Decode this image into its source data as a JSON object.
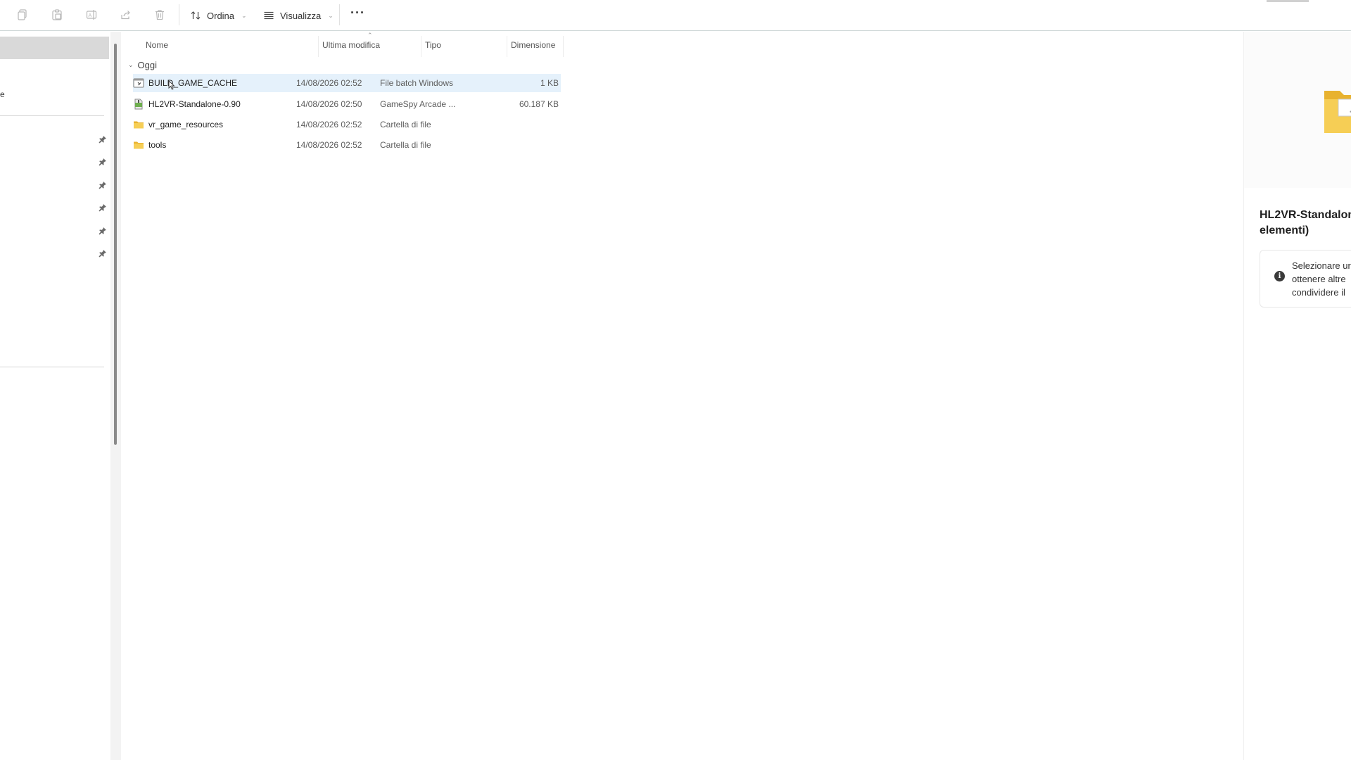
{
  "toolbar": {
    "icons": [
      "copy-icon",
      "paste-icon",
      "rename-icon",
      "share-icon",
      "delete-icon"
    ],
    "sort_label": "Ordina",
    "view_label": "Visualizza",
    "more_label": "···"
  },
  "nav": {
    "partial_label": "e",
    "pinned_count": 6
  },
  "columns": {
    "name": "Nome",
    "modified": "Ultima modifica",
    "type": "Tipo",
    "size": "Dimensione"
  },
  "group": {
    "label": "Oggi"
  },
  "files": [
    {
      "name": "BUILD_GAME_CACHE",
      "modified": "14/08/2026 02:52",
      "type": "File batch Windows",
      "size": "1 KB",
      "icon": "batch-file-icon",
      "selected": true
    },
    {
      "name": "HL2VR-Standalone-0.90",
      "modified": "14/08/2026 02:50",
      "type": "GameSpy Arcade ...",
      "size": "60.187 KB",
      "icon": "archive-file-icon",
      "selected": false
    },
    {
      "name": "vr_game_resources",
      "modified": "14/08/2026 02:52",
      "type": "Cartella di file",
      "size": "",
      "icon": "folder-icon",
      "selected": false
    },
    {
      "name": "tools",
      "modified": "14/08/2026 02:52",
      "type": "Cartella di file",
      "size": "",
      "icon": "folder-icon",
      "selected": false
    }
  ],
  "details": {
    "title_line1": "HL2VR-Standalon",
    "title_line2": "elementi)",
    "info_line1": "Selezionare ur",
    "info_line2": "ottenere altre",
    "info_line3": "condividere il",
    "info_icon_glyph": "i"
  },
  "colors": {
    "selection": "#e5f1fb",
    "folder": "#f4c542",
    "nav_selected": "#d9d9d9"
  }
}
